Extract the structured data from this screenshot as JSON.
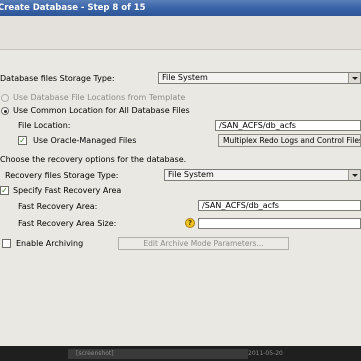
{
  "window": {
    "title": "Create Database - Step 8 of 15"
  },
  "storage": {
    "label": "Database files Storage Type:",
    "value": "File System",
    "radio_template": "Use Database File Locations from Template",
    "radio_common": "Use Common Location for All Database Files",
    "file_location_label": "File Location:",
    "file_location_value": "/SAN_ACFS/db_acfs",
    "omf_label": "Use Oracle-Managed Files",
    "omf_checked": true,
    "multiplex_button": "Multiplex Redo Logs and Control Files..."
  },
  "recovery": {
    "heading": "Choose the recovery options for the database.",
    "storage_label": "Recovery files Storage Type:",
    "storage_value": "File System",
    "specify_fra_label": "Specify Fast Recovery Area",
    "specify_fra_checked": true,
    "fra_label": "Fast Recovery Area:",
    "fra_value": "/SAN_ACFS/db_acfs",
    "fra_size_label": "Fast Recovery Area Size:",
    "fra_size_value": "",
    "archiving_label": "Enable Archiving",
    "archiving_checked": false,
    "edit_archive_button": "Edit Archive Mode Parameters..."
  },
  "taskbar": {
    "task_label": "[screenshot]",
    "tray_text": "2011-05-20"
  },
  "icons": {
    "warning": "warning-icon",
    "dropdown": "chevron-down-icon",
    "check": "check-icon"
  }
}
